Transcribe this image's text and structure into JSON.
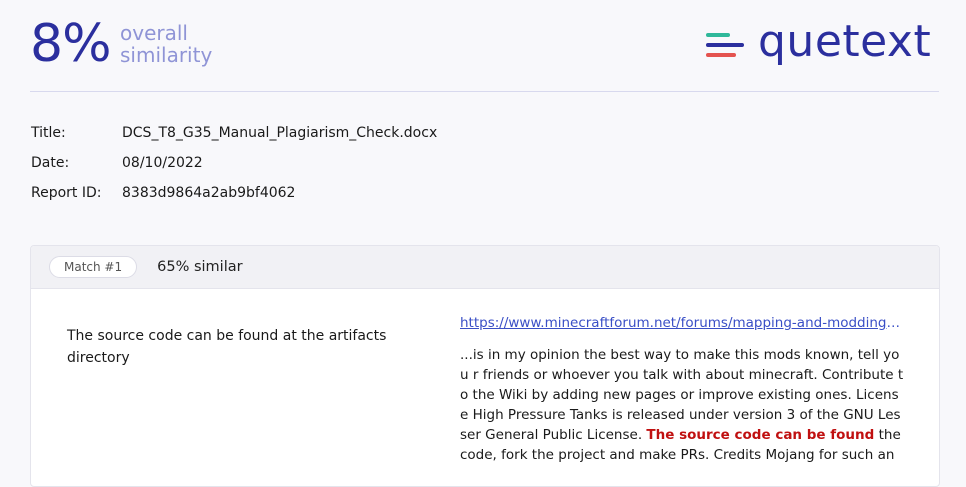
{
  "summary": {
    "similarity_percent": "8%",
    "label_line1": "overall",
    "label_line2": "similarity"
  },
  "brand": {
    "logo_text": "quetext",
    "colors": {
      "primary": "#2b2f9e",
      "accent_green": "#2fb89a",
      "accent_red": "#e4534f",
      "muted": "#8f94d6"
    }
  },
  "meta": [
    {
      "key": "Title:",
      "value": "DCS_T8_G35_Manual_Plagiarism_Check.docx"
    },
    {
      "key": "Date:",
      "value": "08/10/2022"
    },
    {
      "key": "Report ID:",
      "value": "8383d9864a2ab9bf4062"
    }
  ],
  "match": {
    "badge": "Match #1",
    "similarity": "65% similar",
    "submitted_text": "The source code can be found at the artifacts directory",
    "source_url": "https://www.minecraftforum.net/forums/mapping-and-modding-java-edition/minecraft-mods",
    "source_text_before": "...is in my opinion the best way to make this mods known, tell you r friends or whoever you talk with about minecraft. Contribute to the Wiki by adding new pages or improve existing ones. License High Pressure Tanks is released under version 3 of the GNU Lesser General Public License. ",
    "source_text_highlight": "The source code can be found",
    "source_text_after": " the code, fork the project and make PRs. Credits Mojang for such an"
  }
}
